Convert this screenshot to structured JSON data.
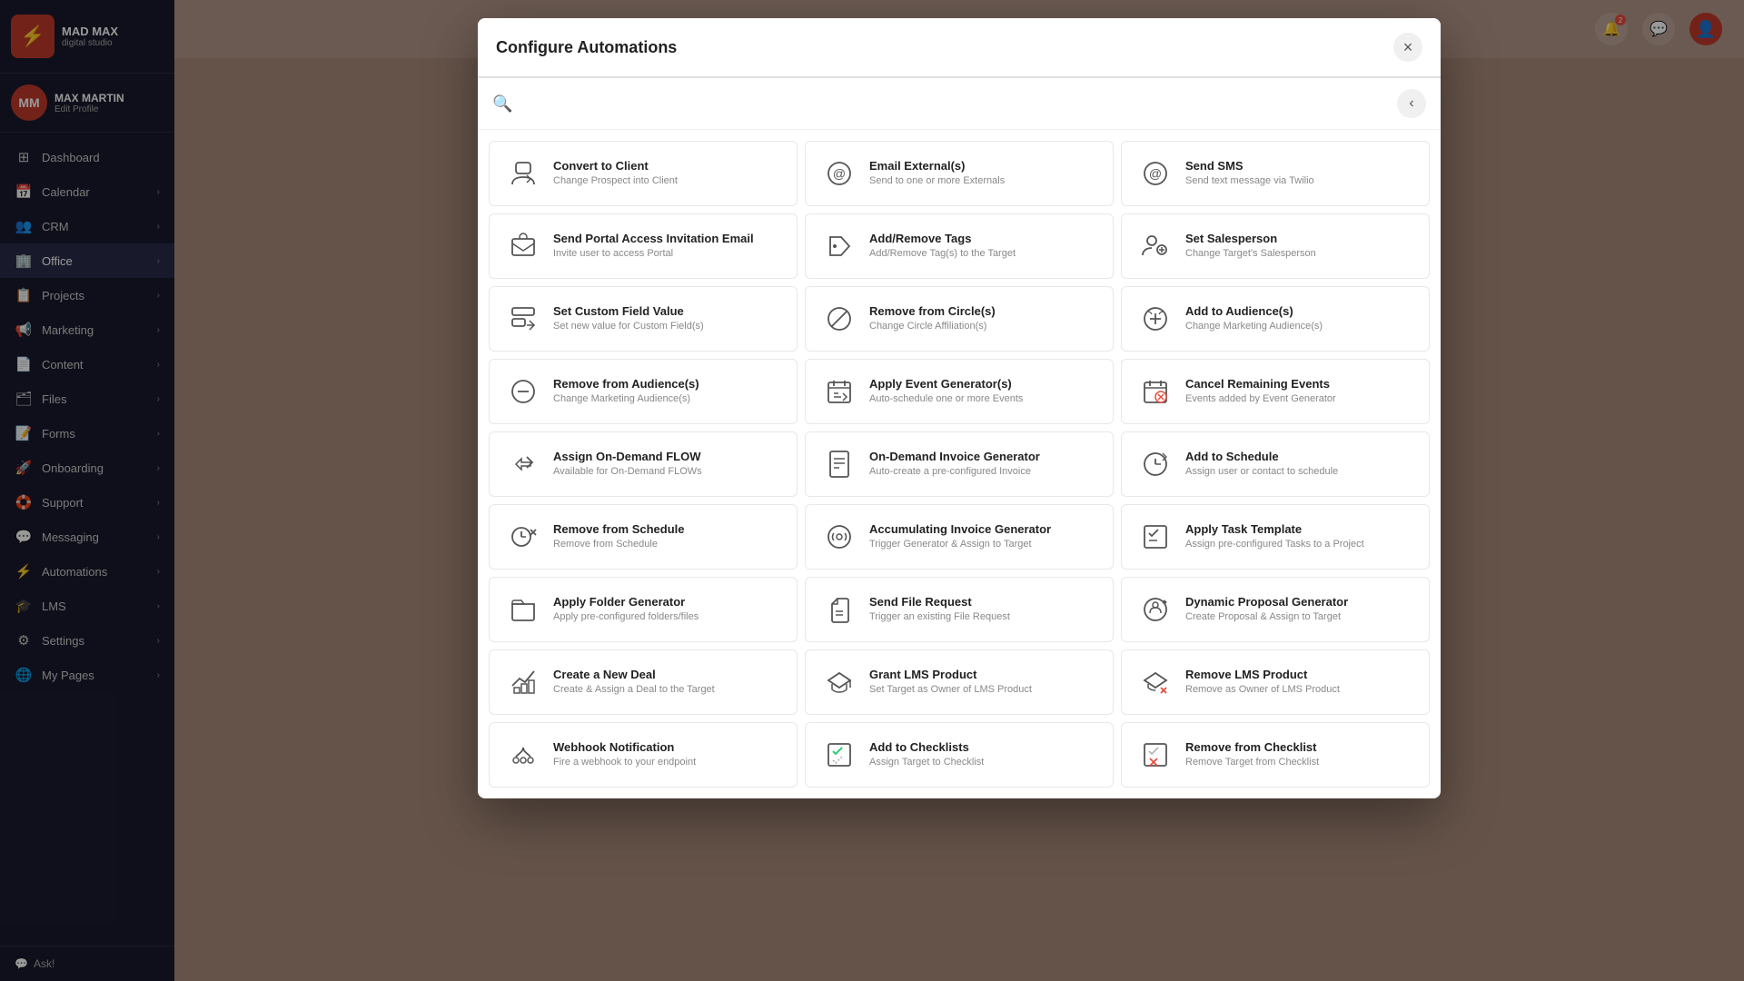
{
  "app": {
    "logo_text": "MAD MAX",
    "logo_sub": "digital studio",
    "logo_symbol": "⚡"
  },
  "user": {
    "name": "MAX MARTIN",
    "edit_label": "Edit Profile",
    "initials": "MM"
  },
  "sidebar": {
    "items": [
      {
        "id": "dashboard",
        "label": "Dashboard",
        "icon": "⊞",
        "active": false
      },
      {
        "id": "calendar",
        "label": "Calendar",
        "icon": "📅",
        "active": false,
        "has_chevron": true
      },
      {
        "id": "crm",
        "label": "CRM",
        "icon": "👥",
        "active": false,
        "has_chevron": true
      },
      {
        "id": "office",
        "label": "Office",
        "icon": "🏢",
        "active": true,
        "has_chevron": true
      },
      {
        "id": "projects",
        "label": "Projects",
        "icon": "📋",
        "active": false,
        "has_chevron": true
      },
      {
        "id": "marketing",
        "label": "Marketing",
        "icon": "📢",
        "active": false,
        "has_chevron": true
      },
      {
        "id": "content",
        "label": "Content",
        "icon": "📄",
        "active": false,
        "has_chevron": true
      },
      {
        "id": "files",
        "label": "Files",
        "icon": "🗂",
        "active": false,
        "has_chevron": true
      },
      {
        "id": "forms",
        "label": "Forms",
        "icon": "📝",
        "active": false,
        "has_chevron": true
      },
      {
        "id": "onboarding",
        "label": "Onboarding",
        "icon": "🚀",
        "active": false,
        "has_chevron": true
      },
      {
        "id": "support",
        "label": "Support",
        "icon": "🛟",
        "active": false,
        "has_chevron": true
      },
      {
        "id": "messaging",
        "label": "Messaging",
        "icon": "💬",
        "active": false,
        "has_chevron": true
      },
      {
        "id": "automations",
        "label": "Automations",
        "icon": "⚡",
        "active": false,
        "has_chevron": true
      },
      {
        "id": "lms",
        "label": "LMS",
        "icon": "🎓",
        "active": false,
        "has_chevron": true
      },
      {
        "id": "settings",
        "label": "Settings",
        "icon": "⚙",
        "active": false,
        "has_chevron": true
      },
      {
        "id": "mypages",
        "label": "My Pages",
        "icon": "🌐",
        "active": false,
        "has_chevron": true
      }
    ],
    "ask_label": "Ask!"
  },
  "topbar": {
    "notification_badge": "2",
    "notification_icon": "🔔",
    "chat_icon": "💬"
  },
  "modal": {
    "title": "Configure Automations",
    "close_label": "×",
    "search_placeholder": "",
    "back_label": "‹",
    "automations": [
      {
        "id": "convert-client",
        "title": "Convert to Client",
        "desc": "Change Prospect into Client",
        "icon": "👤"
      },
      {
        "id": "email-externals",
        "title": "Email External(s)",
        "desc": "Send to one or more Externals",
        "icon": "@"
      },
      {
        "id": "send-sms",
        "title": "Send SMS",
        "desc": "Send text message via Twilio",
        "icon": "@"
      },
      {
        "id": "send-portal",
        "title": "Send Portal Access Invitation Email",
        "desc": "Invite user to access Portal",
        "icon": "✉"
      },
      {
        "id": "add-remove-tags",
        "title": "Add/Remove Tags",
        "desc": "Add/Remove Tag(s) to the Target",
        "icon": "🏷"
      },
      {
        "id": "set-salesperson",
        "title": "Set Salesperson",
        "desc": "Change Target's Salesperson",
        "icon": "👥"
      },
      {
        "id": "set-custom-field",
        "title": "Set Custom Field Value",
        "desc": "Set new value for Custom Field(s)",
        "icon": "✏"
      },
      {
        "id": "remove-circle",
        "title": "Remove from Circle(s)",
        "desc": "Change Circle Affiliation(s)",
        "icon": "⭕"
      },
      {
        "id": "add-audience",
        "title": "Add to Audience(s)",
        "desc": "Change Marketing Audience(s)",
        "icon": "📣"
      },
      {
        "id": "remove-audience",
        "title": "Remove from Audience(s)",
        "desc": "Change Marketing Audience(s)",
        "icon": "🔕"
      },
      {
        "id": "apply-event-gen",
        "title": "Apply Event Generator(s)",
        "desc": "Auto-schedule one or more Events",
        "icon": "📅"
      },
      {
        "id": "cancel-events",
        "title": "Cancel Remaining Events",
        "desc": "Events added by Event Generator",
        "icon": "🚫"
      },
      {
        "id": "assign-flow",
        "title": "Assign On-Demand FLOW",
        "desc": "Available for On-Demand FLOWs",
        "icon": "▶"
      },
      {
        "id": "ondemand-invoice",
        "title": "On-Demand Invoice Generator",
        "desc": "Auto-create a pre-configured Invoice",
        "icon": "🧾"
      },
      {
        "id": "add-schedule",
        "title": "Add to Schedule",
        "desc": "Assign user or contact to schedule",
        "icon": "🗓"
      },
      {
        "id": "remove-schedule",
        "title": "Remove from Schedule",
        "desc": "Remove from Schedule",
        "icon": "📆"
      },
      {
        "id": "acc-invoice-gen",
        "title": "Accumulating Invoice Generator",
        "desc": "Trigger Generator & Assign to Target",
        "icon": "⚙"
      },
      {
        "id": "apply-task-template",
        "title": "Apply Task Template",
        "desc": "Assign pre-configured Tasks to a Project",
        "icon": "☑"
      },
      {
        "id": "apply-folder-gen",
        "title": "Apply Folder Generator",
        "desc": "Apply pre-configured folders/files",
        "icon": "📁"
      },
      {
        "id": "send-file-request",
        "title": "Send File Request",
        "desc": "Trigger an existing File Request",
        "icon": "📎"
      },
      {
        "id": "dynamic-proposal",
        "title": "Dynamic Proposal Generator",
        "desc": "Create Proposal & Assign to Target",
        "icon": "⚙"
      },
      {
        "id": "create-deal",
        "title": "Create a New Deal",
        "desc": "Create & Assign a Deal to the Target",
        "icon": "🤝"
      },
      {
        "id": "grant-lms",
        "title": "Grant LMS Product",
        "desc": "Set Target as Owner of LMS Product",
        "icon": "🎓"
      },
      {
        "id": "remove-lms",
        "title": "Remove LMS Product",
        "desc": "Remove as Owner of LMS Product",
        "icon": "❌"
      },
      {
        "id": "webhook",
        "title": "Webhook Notification",
        "desc": "Fire a webhook to your endpoint",
        "icon": "🔗"
      },
      {
        "id": "add-checklists",
        "title": "Add to Checklists",
        "desc": "Assign Target to Checklist",
        "icon": "✅"
      },
      {
        "id": "remove-checklist",
        "title": "Remove from Checklist",
        "desc": "Remove Target from Checklist",
        "icon": "🗑"
      }
    ]
  }
}
